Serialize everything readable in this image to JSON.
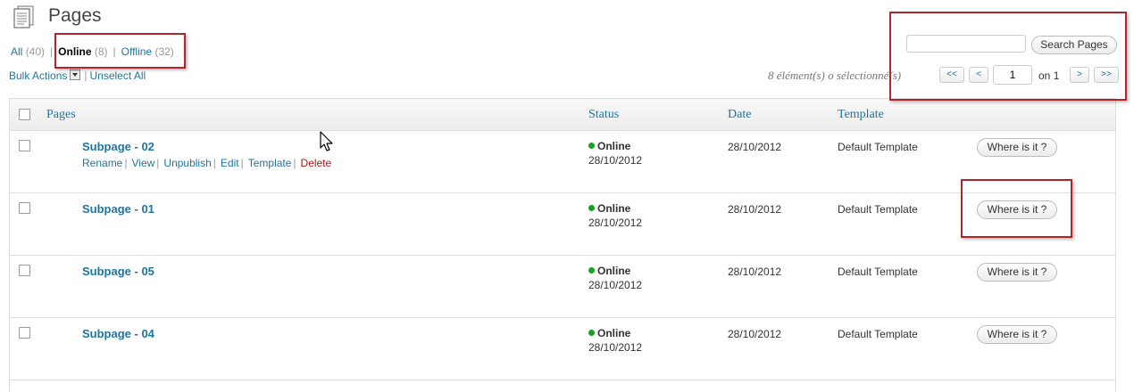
{
  "header": {
    "title": "Pages",
    "icon": "pages-document-icon"
  },
  "filters": {
    "all_label": "All",
    "all_count": "(40)",
    "online_label": "Online",
    "online_count": "(8)",
    "offline_label": "Offline",
    "offline_count": "(32)",
    "separator": "|"
  },
  "bulk": {
    "bulk_label": "Bulk Actions",
    "unselect_label": "Unselect All"
  },
  "search": {
    "placeholder": "",
    "button_label": "Search Pages"
  },
  "pagination": {
    "count_text": "8 élément(s)   o sélectionné(s)",
    "first": "<<",
    "prev": "<",
    "current": "1",
    "of_label": "on",
    "total": "1",
    "next": ">",
    "last": ">>"
  },
  "table": {
    "headers": {
      "pages": "Pages",
      "status": "Status",
      "date": "Date",
      "template": "Template"
    },
    "row_actions": [
      "Rename",
      "View",
      "Unpublish",
      "Edit",
      "Template",
      "Delete"
    ],
    "rows": [
      {
        "title": "Subpage - 02",
        "status": "Online",
        "status_date": "28/10/2012",
        "date": "28/10/2012",
        "template": "Default Template",
        "button": "Where is it ?"
      },
      {
        "title": "Subpage - 01",
        "status": "Online",
        "status_date": "28/10/2012",
        "date": "28/10/2012",
        "template": "Default Template",
        "button": "Where is it ?"
      },
      {
        "title": "Subpage - 05",
        "status": "Online",
        "status_date": "28/10/2012",
        "date": "28/10/2012",
        "template": "Default Template",
        "button": "Where is it ?"
      },
      {
        "title": "Subpage - 04",
        "status": "Online",
        "status_date": "28/10/2012",
        "date": "28/10/2012",
        "template": "Default Template",
        "button": "Where is it ?"
      }
    ]
  },
  "colors": {
    "link": "#21759b",
    "online_dot": "#13a51b",
    "delete": "#bc0b0b",
    "highlight": "#b0242a"
  }
}
